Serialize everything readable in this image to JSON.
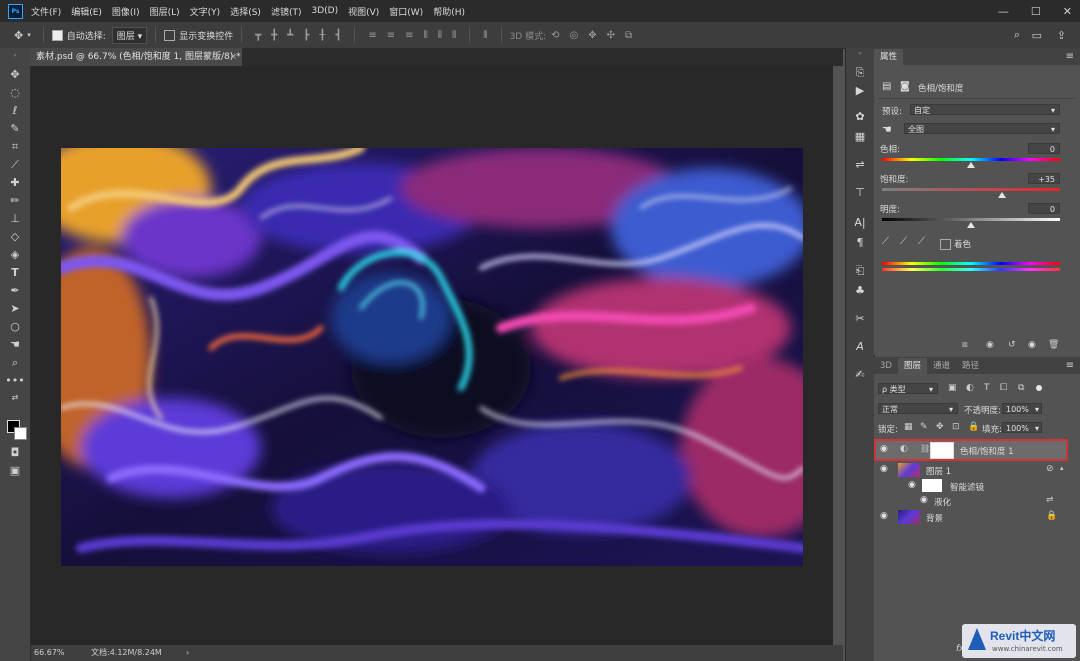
{
  "menubar": {
    "logo": "Ps",
    "items": [
      "文件(F)",
      "编辑(E)",
      "图像(I)",
      "图层(L)",
      "文字(Y)",
      "选择(S)",
      "滤镜(T)",
      "3D(D)",
      "视图(V)",
      "窗口(W)",
      "帮助(H)"
    ],
    "controls": [
      "—",
      "☐",
      "✕"
    ]
  },
  "optionsbar": {
    "auto_select_label": "自动选择:",
    "auto_select_checked": true,
    "auto_select_target": "图层",
    "show_transform_label": "显示变换控件",
    "show_transform_checked": false,
    "mode_3d_label": "3D 模式:"
  },
  "document": {
    "tab_title": "素材.psd @ 66.7% (色相/饱和度 1, 图层蒙版/8) *",
    "close_symbol": "×"
  },
  "statusbar": {
    "zoom": "66.67%",
    "doc_info": "文档:4.12M/8.24M",
    "arrow": "›"
  },
  "properties": {
    "tab_label": "属性",
    "panel_title": "色相/饱和度",
    "preset_label": "预设:",
    "preset_value": "自定",
    "channel_value": "全图",
    "hue_label": "色相:",
    "hue_value": "0",
    "hue_fraction": 0.5,
    "saturation_label": "饱和度:",
    "saturation_value": "+35",
    "saturation_fraction": 0.675,
    "lightness_label": "明度:",
    "lightness_value": "0",
    "lightness_fraction": 0.5,
    "colorize_label": "着色",
    "colorize_checked": false
  },
  "layers": {
    "tabs": [
      "3D",
      "图层",
      "通道",
      "路径"
    ],
    "active_tab": "图层",
    "filter_kind": "类型",
    "blend_mode": "正常",
    "opacity_label": "不透明度:",
    "opacity_value": "100%",
    "lock_label": "锁定:",
    "fill_label": "填充:",
    "fill_value": "100%",
    "items": [
      {
        "name": "色相/饱和度 1",
        "selected": true
      },
      {
        "name": "图层 1"
      },
      {
        "name": "智能滤镜"
      },
      {
        "name": "液化"
      },
      {
        "name": "背景"
      }
    ]
  },
  "watermark": {
    "title": "Revit中文网",
    "subtitle": "www.chinarevit.com"
  },
  "colors": {
    "selection_outline": "#d0343a",
    "accent": "#31a8ff"
  }
}
